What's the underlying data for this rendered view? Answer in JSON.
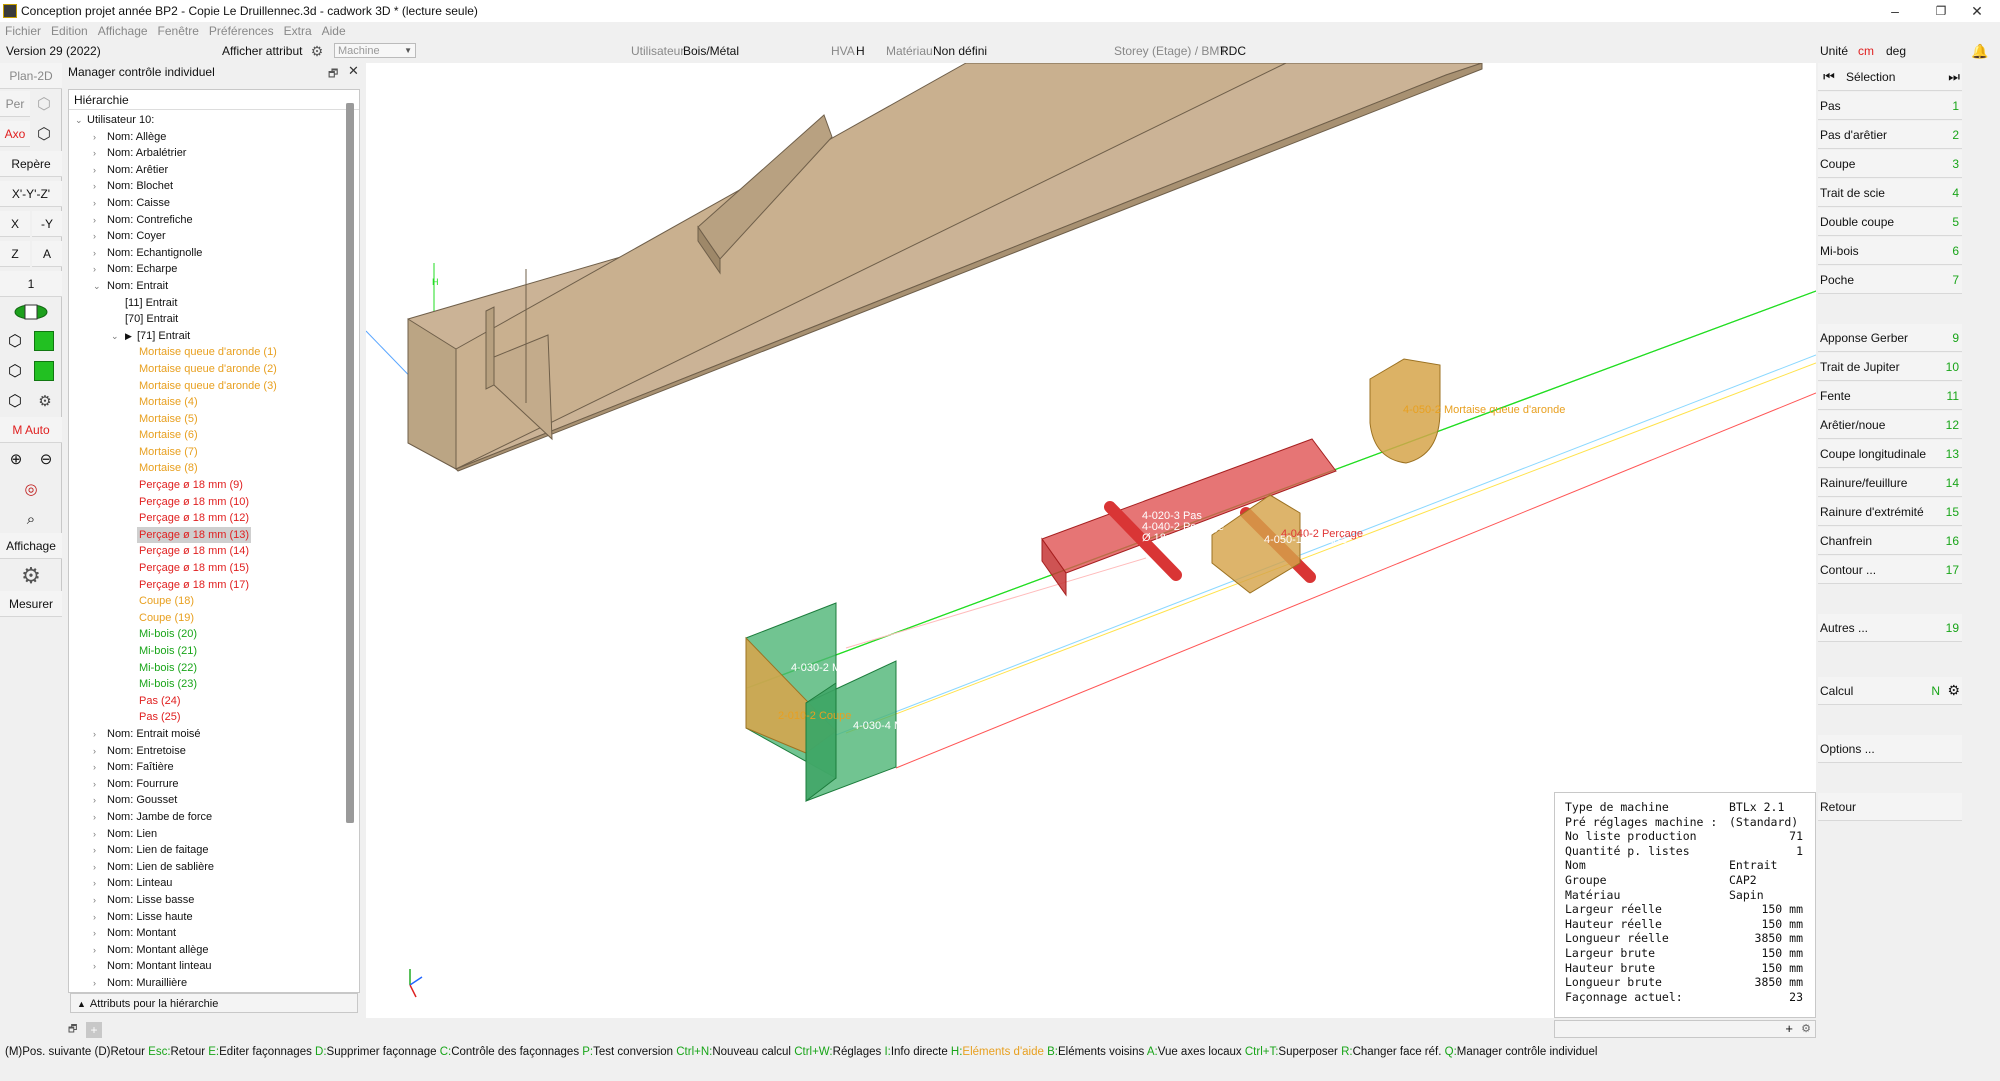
{
  "window": {
    "title": "Conception projet année BP2 - Copie Le Druillennec.3d - cadwork 3D * (lecture seule)",
    "minimize": "–",
    "restore": "❐",
    "close": "✕"
  },
  "menu": [
    "Fichier",
    "Edition",
    "Affichage",
    "Fenêtre",
    "Préférences",
    "Extra",
    "Aide"
  ],
  "topbar": {
    "version": "Version 29 (2022)",
    "show_attr": "Afficher attribut",
    "machine_placeholder": "Machine",
    "user_label": "Utilisateur",
    "user_value": "Bois/Métal",
    "hva_label": "HVA",
    "hva_value": "H",
    "material_label": "Matériau",
    "material_value": "Non défini",
    "storey_label": "Storey (Etage) / BMT",
    "storey_value": "RDC",
    "unit_label": "Unité",
    "unit_value": "cm",
    "angle_unit": "deg"
  },
  "left_toolbar": {
    "plan2d": "Plan-2D",
    "per": "Per",
    "axo": "Axo",
    "repere": "Repère",
    "xyz": "X'-Y'-Z'",
    "x": "X",
    "neg_y": "-Y",
    "z": "Z",
    "a": "A",
    "one": "1",
    "m_auto": "M Auto",
    "affichage": "Affichage",
    "mesurer": "Mesurer"
  },
  "panel": {
    "title": "Manager contrôle individuel",
    "header": "Hiérarchie",
    "attr_toggle": "Attributs pour la hiérarchie"
  },
  "tree": [
    {
      "label": "Utilisateur 10:",
      "level": 0,
      "arrow": "v",
      "color": "#111"
    },
    {
      "label": "Nom: Allège",
      "level": 1,
      "arrow": ">",
      "color": "#111"
    },
    {
      "label": "Nom: Arbalétrier",
      "level": 1,
      "arrow": ">",
      "color": "#111"
    },
    {
      "label": "Nom: Arêtier",
      "level": 1,
      "arrow": ">",
      "color": "#111"
    },
    {
      "label": "Nom: Blochet",
      "level": 1,
      "arrow": ">",
      "color": "#111"
    },
    {
      "label": "Nom: Caisse",
      "level": 1,
      "arrow": ">",
      "color": "#111"
    },
    {
      "label": "Nom: Contrefiche",
      "level": 1,
      "arrow": ">",
      "color": "#111"
    },
    {
      "label": "Nom: Coyer",
      "level": 1,
      "arrow": ">",
      "color": "#111"
    },
    {
      "label": "Nom: Echantignolle",
      "level": 1,
      "arrow": ">",
      "color": "#111"
    },
    {
      "label": "Nom: Echarpe",
      "level": 1,
      "arrow": ">",
      "color": "#111"
    },
    {
      "label": "Nom: Entrait",
      "level": 1,
      "arrow": "v",
      "color": "#111"
    },
    {
      "label": "[11] Entrait",
      "level": 2,
      "arrow": "",
      "color": "#111"
    },
    {
      "label": "[70] Entrait",
      "level": 2,
      "arrow": "",
      "color": "#111"
    },
    {
      "label": "[71] Entrait",
      "level": 2,
      "arrow": "v",
      "color": "#111",
      "marker": "▶"
    },
    {
      "label": "Mortaise queue d'aronde (1)",
      "level": 3,
      "arrow": "",
      "color": "#e8a020"
    },
    {
      "label": "Mortaise queue d'aronde (2)",
      "level": 3,
      "arrow": "",
      "color": "#e8a020"
    },
    {
      "label": "Mortaise queue d'aronde (3)",
      "level": 3,
      "arrow": "",
      "color": "#e8a020"
    },
    {
      "label": "Mortaise (4)",
      "level": 3,
      "arrow": "",
      "color": "#e8a020"
    },
    {
      "label": "Mortaise (5)",
      "level": 3,
      "arrow": "",
      "color": "#e8a020"
    },
    {
      "label": "Mortaise (6)",
      "level": 3,
      "arrow": "",
      "color": "#e8a020"
    },
    {
      "label": "Mortaise (7)",
      "level": 3,
      "arrow": "",
      "color": "#e8a020"
    },
    {
      "label": "Mortaise (8)",
      "level": 3,
      "arrow": "",
      "color": "#e8a020"
    },
    {
      "label": "Perçage ø 18 mm (9)",
      "level": 3,
      "arrow": "",
      "color": "#e02020"
    },
    {
      "label": "Perçage ø 18 mm (10)",
      "level": 3,
      "arrow": "",
      "color": "#e02020"
    },
    {
      "label": "Perçage ø 18 mm (12)",
      "level": 3,
      "arrow": "",
      "color": "#e02020"
    },
    {
      "label": "Perçage ø 18 mm (13)",
      "level": 3,
      "arrow": "",
      "color": "#e02020",
      "selected": true
    },
    {
      "label": "Perçage ø 18 mm (14)",
      "level": 3,
      "arrow": "",
      "color": "#e02020"
    },
    {
      "label": "Perçage ø 18 mm (15)",
      "level": 3,
      "arrow": "",
      "color": "#e02020"
    },
    {
      "label": "Perçage ø 18 mm (17)",
      "level": 3,
      "arrow": "",
      "color": "#e02020"
    },
    {
      "label": "Coupe (18)",
      "level": 3,
      "arrow": "",
      "color": "#e8a020"
    },
    {
      "label": "Coupe (19)",
      "level": 3,
      "arrow": "",
      "color": "#e8a020"
    },
    {
      "label": "Mi-bois (20)",
      "level": 3,
      "arrow": "",
      "color": "#19a519"
    },
    {
      "label": "Mi-bois (21)",
      "level": 3,
      "arrow": "",
      "color": "#19a519"
    },
    {
      "label": "Mi-bois (22)",
      "level": 3,
      "arrow": "",
      "color": "#19a519"
    },
    {
      "label": "Mi-bois (23)",
      "level": 3,
      "arrow": "",
      "color": "#19a519"
    },
    {
      "label": "Pas (24)",
      "level": 3,
      "arrow": "",
      "color": "#e02020"
    },
    {
      "label": "Pas (25)",
      "level": 3,
      "arrow": "",
      "color": "#e02020"
    },
    {
      "label": "Nom: Entrait moisé",
      "level": 1,
      "arrow": ">",
      "color": "#111"
    },
    {
      "label": "Nom: Entretoise",
      "level": 1,
      "arrow": ">",
      "color": "#111"
    },
    {
      "label": "Nom: Faîtière",
      "level": 1,
      "arrow": ">",
      "color": "#111"
    },
    {
      "label": "Nom: Fourrure",
      "level": 1,
      "arrow": ">",
      "color": "#111"
    },
    {
      "label": "Nom: Gousset",
      "level": 1,
      "arrow": ">",
      "color": "#111"
    },
    {
      "label": "Nom: Jambe de force",
      "level": 1,
      "arrow": ">",
      "color": "#111"
    },
    {
      "label": "Nom: Lien",
      "level": 1,
      "arrow": ">",
      "color": "#111"
    },
    {
      "label": "Nom: Lien de faitage",
      "level": 1,
      "arrow": ">",
      "color": "#111"
    },
    {
      "label": "Nom: Lien de sablière",
      "level": 1,
      "arrow": ">",
      "color": "#111"
    },
    {
      "label": "Nom: Linteau",
      "level": 1,
      "arrow": ">",
      "color": "#111"
    },
    {
      "label": "Nom: Lisse basse",
      "level": 1,
      "arrow": ">",
      "color": "#111"
    },
    {
      "label": "Nom: Lisse haute",
      "level": 1,
      "arrow": ">",
      "color": "#111"
    },
    {
      "label": "Nom: Montant",
      "level": 1,
      "arrow": ">",
      "color": "#111"
    },
    {
      "label": "Nom: Montant allège",
      "level": 1,
      "arrow": ">",
      "color": "#111"
    },
    {
      "label": "Nom: Montant linteau",
      "level": 1,
      "arrow": ">",
      "color": "#111"
    },
    {
      "label": "Nom: Muraillière",
      "level": 1,
      "arrow": ">",
      "color": "#111"
    }
  ],
  "viewport_labels": {
    "l1": "4-050-2 Mortaise queue d'aronde",
    "l2": "4-020-3 Pas",
    "l3": "4-040-2 Perçage",
    "l4": "Ø 18mm",
    "l5": "4-040-2 Perçage",
    "l6": "4-050-1 Mortaise",
    "l7": "4-030-2 Mi-bois",
    "l8": "2-010-2 Coupe",
    "l9": "4-030-4 Mi-bois",
    "l10": "H"
  },
  "right_panel": {
    "selection": "Sélection",
    "buttons": [
      {
        "label": "Pas",
        "num": "1"
      },
      {
        "label": "Pas d'arêtier",
        "num": "2"
      },
      {
        "label": "Coupe",
        "num": "3"
      },
      {
        "label": "Trait de scie",
        "num": "4"
      },
      {
        "label": "Double coupe",
        "num": "5"
      },
      {
        "label": "Mi-bois",
        "num": "6"
      },
      {
        "label": "Poche",
        "num": "7"
      },
      {
        "label": "Apponse Gerber",
        "num": "9"
      },
      {
        "label": "Trait de Jupiter",
        "num": "10"
      },
      {
        "label": "Fente",
        "num": "11"
      },
      {
        "label": "Arêtier/noue",
        "num": "12"
      },
      {
        "label": "Coupe longitudinale",
        "num": "13"
      },
      {
        "label": "Rainure/feuillure",
        "num": "14"
      },
      {
        "label": "Rainure d'extrémité",
        "num": "15"
      },
      {
        "label": "Chanfrein",
        "num": "16"
      },
      {
        "label": "Contour ...",
        "num": "17"
      },
      {
        "label": "Autres ...",
        "num": "19"
      }
    ],
    "calcul": "Calcul",
    "calcul_flag": "N",
    "options": "Options ...",
    "retour": "Retour"
  },
  "info": [
    {
      "k": "Type de machine",
      "v": "BTLx 2.1",
      "u": ""
    },
    {
      "k": "Pré réglages machine :",
      "v": "(Standard)",
      "u": ""
    },
    {
      "k": "No liste production",
      "v": "71",
      "u": ""
    },
    {
      "k": "Quantité p. listes",
      "v": "1",
      "u": ""
    },
    {
      "k": "Nom",
      "v": "Entrait",
      "u": ""
    },
    {
      "k": "Groupe",
      "v": "CAP2",
      "u": ""
    },
    {
      "k": "Matériau",
      "v": "Sapin",
      "u": ""
    },
    {
      "k": "Largeur réelle",
      "v": "150",
      "u": "mm"
    },
    {
      "k": "Hauteur réelle",
      "v": "150",
      "u": "mm"
    },
    {
      "k": "Longueur réelle",
      "v": "3850",
      "u": "mm"
    },
    {
      "k": "Largeur brute",
      "v": "150",
      "u": "mm"
    },
    {
      "k": "Hauteur brute",
      "v": "150",
      "u": "mm"
    },
    {
      "k": "Longueur brute",
      "v": "3850",
      "u": "mm"
    },
    {
      "k": "Façonnage actuel:",
      "v": "23",
      "u": ""
    }
  ],
  "status": [
    {
      "key": "(M)",
      "text": "Pos. suivante ",
      "color": "#111"
    },
    {
      "key": "(D)",
      "text": "Retour ",
      "color": "#111"
    },
    {
      "key": "Esc:",
      "text": "Retour ",
      "color": "#19a519"
    },
    {
      "key": "E:",
      "text": "Editer façonnages ",
      "color": "#19a519"
    },
    {
      "key": "D:",
      "text": "Supprimer façonnage ",
      "color": "#19a519"
    },
    {
      "key": "C:",
      "text": "Contrôle des façonnages ",
      "color": "#19a519"
    },
    {
      "key": "P:",
      "text": "Test conversion ",
      "color": "#19a519"
    },
    {
      "key": "Ctrl+N:",
      "text": "Nouveau calcul ",
      "color": "#19a519"
    },
    {
      "key": "Ctrl+W:",
      "text": "Réglages ",
      "color": "#19a519"
    },
    {
      "key": "I:",
      "text": "Info directe ",
      "color": "#19a519"
    },
    {
      "key": "H:",
      "text": "Eléments d'aide ",
      "color": "#19a519",
      "textcolor": "#e8a020"
    },
    {
      "key": "B:",
      "text": "Eléments voisins ",
      "color": "#19a519"
    },
    {
      "key": "A:",
      "text": "Vue axes locaux ",
      "color": "#19a519"
    },
    {
      "key": "Ctrl+T:",
      "text": "Superposer ",
      "color": "#19a519"
    },
    {
      "key": "R:",
      "text": "Changer face réf. ",
      "color": "#19a519"
    },
    {
      "key": "Q:",
      "text": "Manager contrôle individuel",
      "color": "#19a519"
    }
  ]
}
